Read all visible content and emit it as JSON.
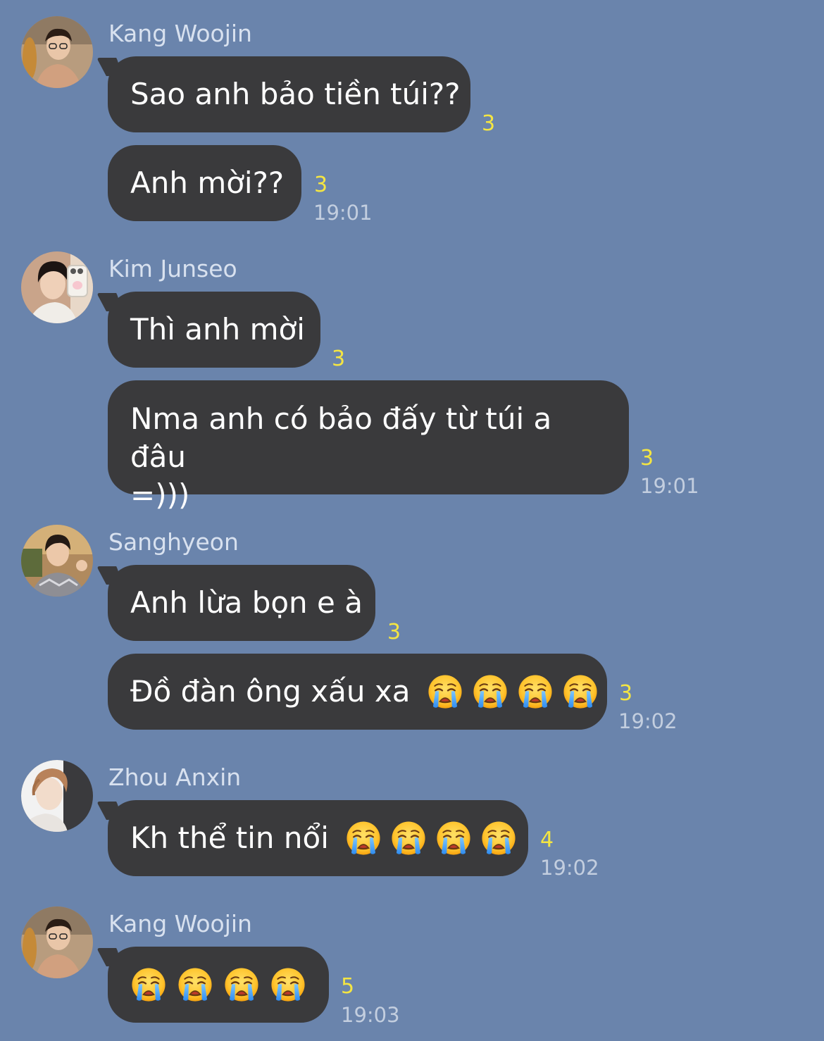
{
  "colors": {
    "background": "#6a84ac",
    "bubble": "#3a3a3c",
    "bubble_text": "#ffffff",
    "sender_name": "#d8e1ef",
    "unread_count": "#f4e542",
    "timestamp": "#c3cedf"
  },
  "groups": [
    {
      "sender": "Kang Woojin",
      "avatar_icon": "avatar-kang-woojin",
      "messages": [
        {
          "text": "Sao anh bảo tiền túi??",
          "unread": "3"
        },
        {
          "text": "Anh mời??",
          "unread": "3",
          "time": "19:01"
        }
      ]
    },
    {
      "sender": "Kim Junseo",
      "avatar_icon": "avatar-kim-junseo",
      "messages": [
        {
          "text": "Thì anh mời",
          "unread": "3"
        },
        {
          "text_line1": "Nma anh có bảo đấy từ túi a đâu",
          "text_line2": "=)))",
          "unread": "3",
          "time": "19:01"
        }
      ]
    },
    {
      "sender": "Sanghyeon",
      "avatar_icon": "avatar-sanghyeon",
      "messages": [
        {
          "text": "Anh lừa bọn e à",
          "unread": "3"
        },
        {
          "text": "Đồ đàn ông xấu xa",
          "emojis": [
            "loudly-crying-face",
            "loudly-crying-face",
            "loudly-crying-face",
            "loudly-crying-face"
          ],
          "unread": "3",
          "time": "19:02"
        }
      ]
    },
    {
      "sender": "Zhou Anxin",
      "avatar_icon": "avatar-zhou-anxin",
      "messages": [
        {
          "text": "Kh thể tin nổi",
          "emojis": [
            "loudly-crying-face",
            "loudly-crying-face",
            "loudly-crying-face",
            "loudly-crying-face"
          ],
          "unread": "4",
          "time": "19:02"
        }
      ]
    },
    {
      "sender": "Kang Woojin",
      "avatar_icon": "avatar-kang-woojin",
      "messages": [
        {
          "emojis": [
            "loudly-crying-face",
            "loudly-crying-face",
            "loudly-crying-face",
            "loudly-crying-face"
          ],
          "unread": "5",
          "time": "19:03"
        }
      ]
    }
  ]
}
